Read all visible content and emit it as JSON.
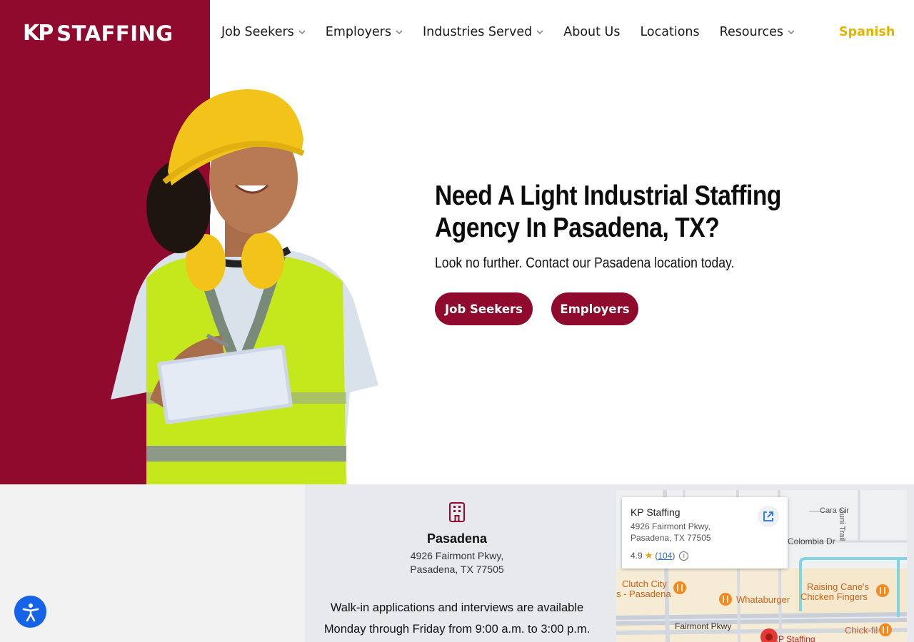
{
  "brand": {
    "logo_text_kp": "KP",
    "logo_text_rest": "STAFFING"
  },
  "nav": {
    "items": [
      {
        "label": "Job Seekers",
        "has_dropdown": true
      },
      {
        "label": "Employers",
        "has_dropdown": true
      },
      {
        "label": "Industries Served",
        "has_dropdown": true
      },
      {
        "label": "About Us",
        "has_dropdown": false
      },
      {
        "label": "Locations",
        "has_dropdown": false
      },
      {
        "label": "Resources",
        "has_dropdown": true
      }
    ],
    "language_label": "Spanish"
  },
  "hero": {
    "title": "Need A Light Industrial Staffing Agency In Pasadena, TX?",
    "subtitle": "Look no further. Contact our Pasadena location today.",
    "buttons": {
      "job_seekers": "Job Seekers",
      "employers": "Employers"
    }
  },
  "location": {
    "name": "Pasadena",
    "address_line1": "4926 Fairmont Pkwy,",
    "address_line2": "Pasadena, TX 77505",
    "hours_line1": "Walk-in applications and interviews are available",
    "hours_line2": "Monday through Friday from 9:00 a.m. to 3:00 p.m."
  },
  "map": {
    "card_title": "KP Staffing",
    "card_address1": "4926 Fairmont Pkwy,",
    "card_address2": "Pasadena, TX 77505",
    "rating": "4.9",
    "review_count": "104",
    "labels": {
      "cara_cir": "Cara Cir",
      "zuni_trail": "Zuni Trail",
      "colombia_dr": "Colombia Dr",
      "clutch_city_1": "Clutch City",
      "clutch_city_2": "s - Pasadena",
      "whataburger": "Whataburger",
      "raising_canes_1": "Raising Cane's",
      "raising_canes_2": "Chicken Fingers",
      "fairmont_pkwy": "Fairmont Pkwy",
      "chick_fil_a": "Chick-fil-A",
      "kp_staffing_pin": "KP Staffing"
    }
  },
  "colors": {
    "brand_crimson": "#8f0a2c",
    "accent_yellow": "#e5b400",
    "a11y_blue": "#1463e8"
  }
}
